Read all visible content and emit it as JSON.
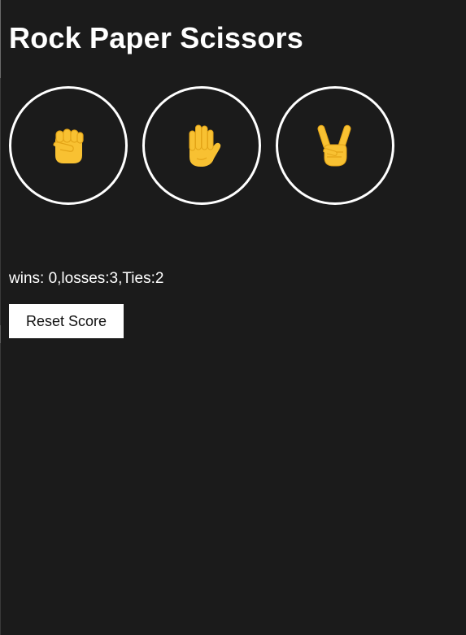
{
  "app": {
    "title": "Rock Paper Scissors"
  },
  "moves": [
    {
      "name": "rock",
      "icon": "raised-fist-icon"
    },
    {
      "name": "paper",
      "icon": "raised-hand-icon"
    },
    {
      "name": "scissors",
      "icon": "victory-hand-icon"
    }
  ],
  "score": {
    "text": "wins: 0,losses:3,Ties:2"
  },
  "controls": {
    "reset_label": "Reset Score"
  },
  "colors": {
    "background": "#1b1b1b",
    "text": "#ffffff",
    "emoji_yellow": "#f8c132",
    "emoji_shade": "#e3a417",
    "button_bg": "#ffffff"
  }
}
